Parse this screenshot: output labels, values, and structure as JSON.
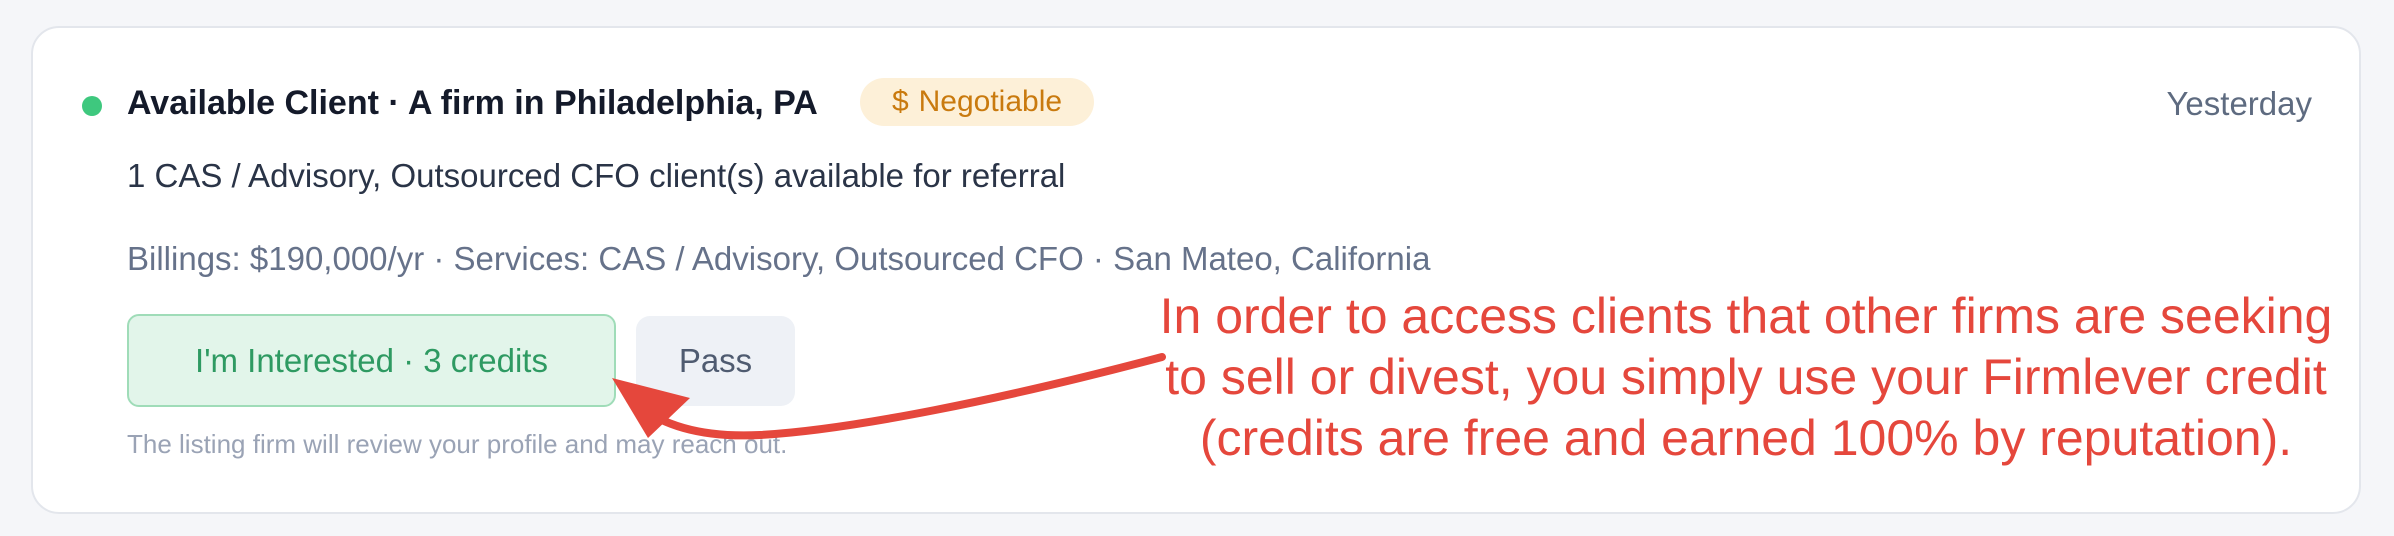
{
  "card": {
    "title": "Available Client · A firm in Philadelphia, PA",
    "badge": {
      "icon": "dollar-icon",
      "icon_glyph": "$",
      "label": "Negotiable"
    },
    "timestamp": "Yesterday",
    "summary": "1 CAS / Advisory, Outsourced CFO client(s) available for referral",
    "details": "Billings: $190,000/yr · Services: CAS / Advisory, Outsourced CFO · San Mateo, California",
    "actions": {
      "interested_label": "I'm Interested · 3 credits",
      "pass_label": "Pass"
    },
    "note": "The listing firm will review your profile and may reach out."
  },
  "annotation": {
    "lines": [
      "In order to access clients that other firms are seeking",
      "to sell or divest, you simply use your Firmlever credit",
      "(credits are free and earned 100% by reputation)."
    ]
  },
  "colors": {
    "status_dot": "#3ec87e",
    "badge_bg": "#fdf0d8",
    "badge_text": "#c97a0e",
    "interested_bg": "#e2f5ea",
    "interested_text": "#2e9a62",
    "annotation": "#e5473c"
  }
}
